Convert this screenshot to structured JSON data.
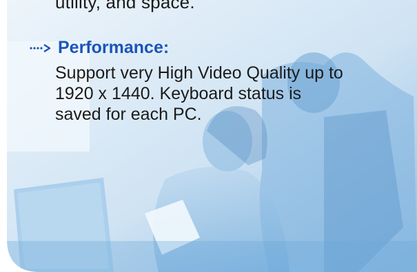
{
  "previous_line": "utility, and space.",
  "section": {
    "icon": "dotted-arrow-icon",
    "heading": "Performance:",
    "body_lines": [
      "Support very High Video Quality up to",
      "1920 x 1440. Keyboard status is",
      "saved for each PC."
    ]
  },
  "colors": {
    "heading": "#1a55b8",
    "text": "#1b1b1b",
    "background_tint": "#a9cdeb"
  }
}
